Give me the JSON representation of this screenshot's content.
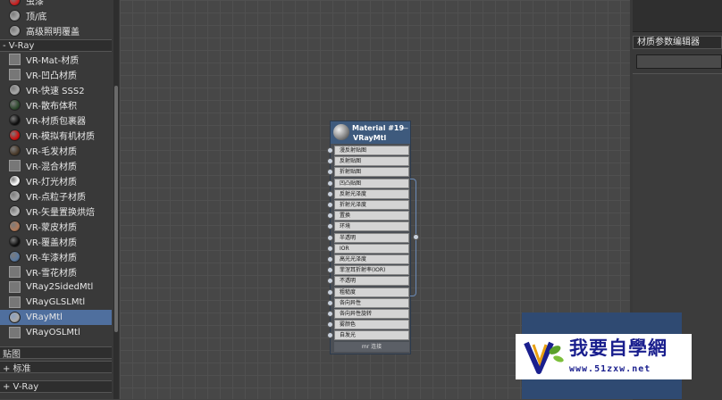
{
  "materials_top": [
    {
      "label": "虫漆",
      "swatch": "#cc2020",
      "shape": "ball"
    },
    {
      "label": "顶/底",
      "swatch": "#aaaaaa",
      "shape": "ball"
    },
    {
      "label": "高级照明覆盖",
      "swatch": "#aaaaaa",
      "shape": "ball"
    }
  ],
  "vray_group_label": "- V-Ray",
  "vray_materials": [
    {
      "label": "VR-Mat-材质",
      "swatch": "#777777",
      "shape": "square"
    },
    {
      "label": "VR-凹凸材质",
      "swatch": "#777777",
      "shape": "square"
    },
    {
      "label": "VR-快速 SSS2",
      "swatch": "#aaaaaa",
      "shape": "ball"
    },
    {
      "label": "VR-散布体积",
      "swatch": "#2e4a2e",
      "shape": "ball"
    },
    {
      "label": "VR-材质包裹器",
      "swatch": "#111111",
      "shape": "ball"
    },
    {
      "label": "VR-模拟有机材质",
      "swatch": "#cc1010",
      "shape": "ball"
    },
    {
      "label": "VR-毛发材质",
      "swatch": "#4a3a2a",
      "shape": "ball"
    },
    {
      "label": "VR-混合材质",
      "swatch": "#777777",
      "shape": "square"
    },
    {
      "label": "VR-灯光材质",
      "swatch": "#ffffff",
      "shape": "ball"
    },
    {
      "label": "VR-点粒子材质",
      "swatch": "#aaaaaa",
      "shape": "ball"
    },
    {
      "label": "VR-矢量置换烘焙",
      "swatch": "#bbbbbb",
      "shape": "ball"
    },
    {
      "label": "VR-蒙皮材质",
      "swatch": "#b07a5a",
      "shape": "ball"
    },
    {
      "label": "VR-覆盖材质",
      "swatch": "#111111",
      "shape": "ball"
    },
    {
      "label": "VR-车漆材质",
      "swatch": "#5a7aa0",
      "shape": "ball"
    },
    {
      "label": "VR-雪花材质",
      "swatch": "#777777",
      "shape": "square"
    },
    {
      "label": "VRay2SidedMtl",
      "swatch": "#777777",
      "shape": "square"
    },
    {
      "label": "VRayGLSLMtl",
      "swatch": "#777777",
      "shape": "square"
    },
    {
      "label": "VRayMtl",
      "swatch": "#aaaaaa",
      "shape": "ball",
      "selected": true
    },
    {
      "label": "VRayOSLMtl",
      "swatch": "#777777",
      "shape": "square"
    }
  ],
  "section_maps": "贴图",
  "section_standard": "+ 标准",
  "section_vray": "+ V-Ray",
  "node": {
    "title": "Material #19",
    "subtitle": "VRayMtl",
    "collapse": "—",
    "footer": "mr 连接",
    "slots": [
      "漫反射贴图",
      "反射贴图",
      "折射贴图",
      "凹凸贴图",
      "反射光泽度",
      "折射光泽度",
      "置换",
      "环境",
      "半透明",
      "IOR",
      "高光光泽度",
      "菲涅耳折射率(IOR)",
      "不透明",
      "粗糙度",
      "各向异性",
      "各向异性旋转",
      "雾颜色",
      "自发光"
    ]
  },
  "right_panel": {
    "title": "材质参数编辑器"
  },
  "watermark": {
    "brand": "我要自學網",
    "url": "www.51zxw.net"
  },
  "colors": {
    "selection": "#4f6f9e",
    "node_header": "#3e5a7d",
    "logo_blue": "#2f4a72",
    "logo_text": "#1a1f8e"
  }
}
